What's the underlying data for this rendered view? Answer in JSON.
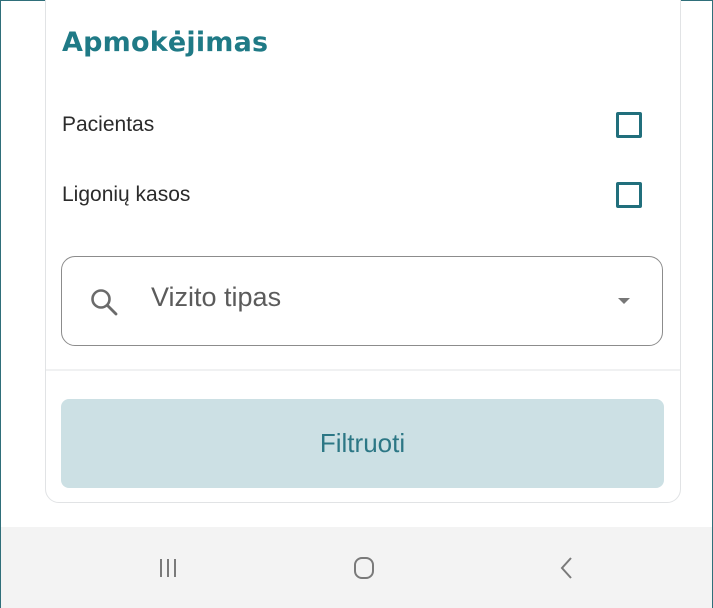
{
  "payment_section": {
    "title": "Apmokėjimas",
    "options": [
      {
        "label": "Pacientas",
        "checked": false
      },
      {
        "label": "Ligonių kasos",
        "checked": false
      }
    ]
  },
  "visit_type_select": {
    "placeholder": "Vizito tipas",
    "icon": "search-icon",
    "trailing_icon": "chevron-down-icon"
  },
  "filter_button": {
    "label": "Filtruoti"
  },
  "navigation_bar": {
    "buttons": [
      "recent-apps-icon",
      "home-icon",
      "back-icon"
    ]
  },
  "colors": {
    "accent": "#1f7a86",
    "checkbox_border": "#216f7c",
    "button_background": "#cce0e4",
    "button_text": "#2c7785",
    "nav_background": "#f3f3f3"
  }
}
